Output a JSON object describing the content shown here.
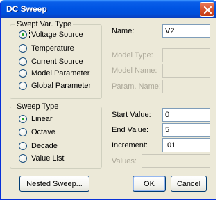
{
  "window": {
    "title": "DC Sweep"
  },
  "swept_var": {
    "group_label": "Swept Var. Type",
    "options": [
      {
        "label": "Voltage Source",
        "checked": true
      },
      {
        "label": "Temperature",
        "checked": false
      },
      {
        "label": "Current Source",
        "checked": false
      },
      {
        "label": "Model Parameter",
        "checked": false
      },
      {
        "label": "Global Parameter",
        "checked": false
      }
    ]
  },
  "sweep_type": {
    "group_label": "Sweep Type",
    "options": [
      {
        "label": "Linear",
        "checked": true
      },
      {
        "label": "Octave",
        "checked": false
      },
      {
        "label": "Decade",
        "checked": false
      },
      {
        "label": "Value List",
        "checked": false
      }
    ]
  },
  "fields": {
    "name": {
      "label": "Name:",
      "value": "V2"
    },
    "model_type": {
      "label": "Model Type:",
      "value": ""
    },
    "model_name": {
      "label": "Model Name:",
      "value": ""
    },
    "param_name": {
      "label": "Param. Name:",
      "value": ""
    },
    "start_value": {
      "label": "Start Value:",
      "value": "0"
    },
    "end_value": {
      "label": "End Value:",
      "value": "5"
    },
    "increment": {
      "label": "Increment:",
      "value": ".01"
    },
    "values": {
      "label": "Values:",
      "value": ""
    }
  },
  "buttons": {
    "nested_sweep": "Nested Sweep...",
    "ok": "OK",
    "cancel": "Cancel"
  }
}
